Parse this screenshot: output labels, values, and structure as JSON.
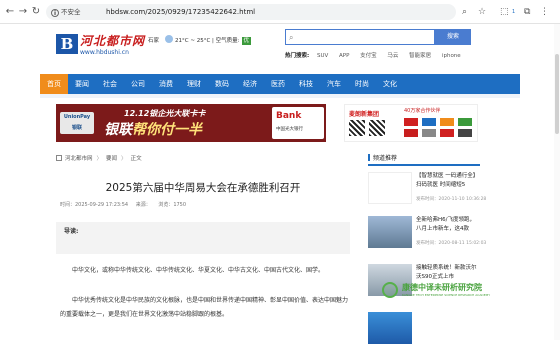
{
  "browser": {
    "security_label": "不安全",
    "url": "hbdsw.com/2025/0929/17235422642.html",
    "extension_badge": "1"
  },
  "site": {
    "logo_cn": "河北都市网",
    "logo_en": "www.hbdushi.cn",
    "logo_mark": "B",
    "city": "石家",
    "weather_text": "21°C ~ 25°C | 空气质量:",
    "air_quality": "优",
    "search_button": "搜索",
    "hot_label": "热门搜索:",
    "hot_keywords": [
      "SUV",
      "APP",
      "支付宝",
      "马云",
      "智能家居",
      "iphone"
    ]
  },
  "nav": {
    "items": [
      "首页",
      "要闻",
      "社会",
      "公司",
      "消费",
      "理财",
      "数码",
      "经济",
      "医药",
      "科技",
      "汽车",
      "时尚",
      "文化"
    ],
    "active_index": 0
  },
  "ads": {
    "banner_card_top": "UnionPay",
    "banner_card_bottom": "银联",
    "banner_line1": "12.12银企光大联卡卡",
    "banner_line2a": "银联",
    "banner_line2b": "帮你付一半",
    "banner_bank_e": "Bank",
    "banner_bank_name": "中国光大银行",
    "ad2_brand": "麦朗新集团",
    "ad3_header": "40万家合作伙伴"
  },
  "article": {
    "breadcrumb": [
      "河北都市网",
      "要闻",
      "正文"
    ],
    "title": "2025第六届中华周易大会在承德胜利召开",
    "time": "时间：2025-09-29 17:23:54",
    "source": "来源：",
    "views": "浏览：1750",
    "lead_label": "导读:",
    "paragraphs": [
      "中华文化，或称中华传统文化、中华传统文化、华夏文化、中华古文化、中国古代文化、国学。",
      "中华优秀传统文化是中华民族的文化根脉，也是中国和世界传递中国精神、彰显中国价值、表达中国魅力的重要载体之一，更是我们在世界文化激荡中站稳脚跟的根基。"
    ]
  },
  "sidebar": {
    "heading": "频道推荐",
    "items": [
      {
        "title": "【智慧就医 一码通行全】扫码就医 时间缩短5",
        "time": "发布时间：2020-11-10 10:36:28"
      },
      {
        "title": "全新哈弗H6/飞度领跑，八月上市新车，这4款",
        "time": "发布时间：2020-08-11 15:02:03"
      },
      {
        "title": "接触轻质系统！新款沃尔沃S90正式上市",
        "time": ""
      },
      {
        "title": "",
        "time": ""
      }
    ]
  },
  "watermark": {
    "cn": "康德中译未研析研究院",
    "en": "KANGDE TECH ENTERPRISE SCIENCE RESEARCH ACADEMY"
  }
}
